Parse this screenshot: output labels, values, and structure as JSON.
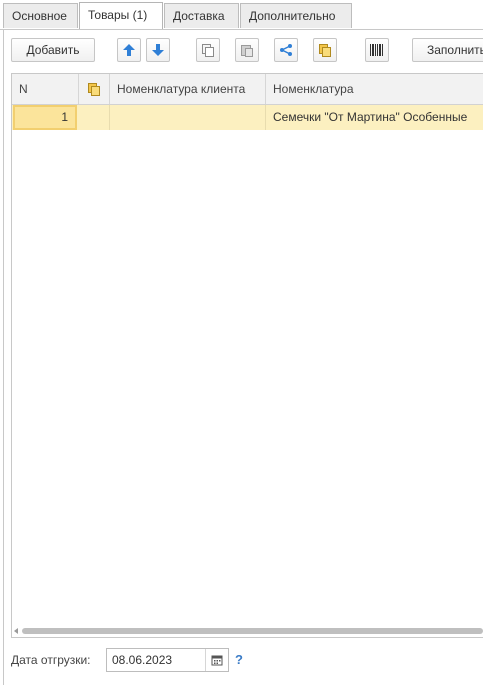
{
  "tabs": [
    {
      "label": "Основное",
      "active": false
    },
    {
      "label": "Товары (1)",
      "active": true
    },
    {
      "label": "Доставка",
      "active": false
    },
    {
      "label": "Дополнительно",
      "active": false
    }
  ],
  "toolbar": {
    "add_label": "Добавить",
    "fill_label": "Заполнить",
    "icons": [
      "move-up-icon",
      "move-down-icon",
      "copy-icon",
      "paste-icon",
      "share-icon",
      "pick-icon",
      "barcode-icon"
    ]
  },
  "table": {
    "columns": [
      "N",
      "",
      "Номенклатура клиента",
      "Номенклатура"
    ],
    "rows": [
      {
        "n": "1",
        "client_item": "",
        "item": "Семечки \"От Мартина\" Особенные"
      }
    ]
  },
  "footer": {
    "ship_date_label": "Дата отгрузки:",
    "ship_date_value": "08.06.2023",
    "help_symbol": "?"
  },
  "colors": {
    "row_highlight": "#fcf0c0",
    "cell_selected": "#fbe49b",
    "arrow_blue": "#2f7fd6",
    "help_blue": "#3b7cc7"
  }
}
